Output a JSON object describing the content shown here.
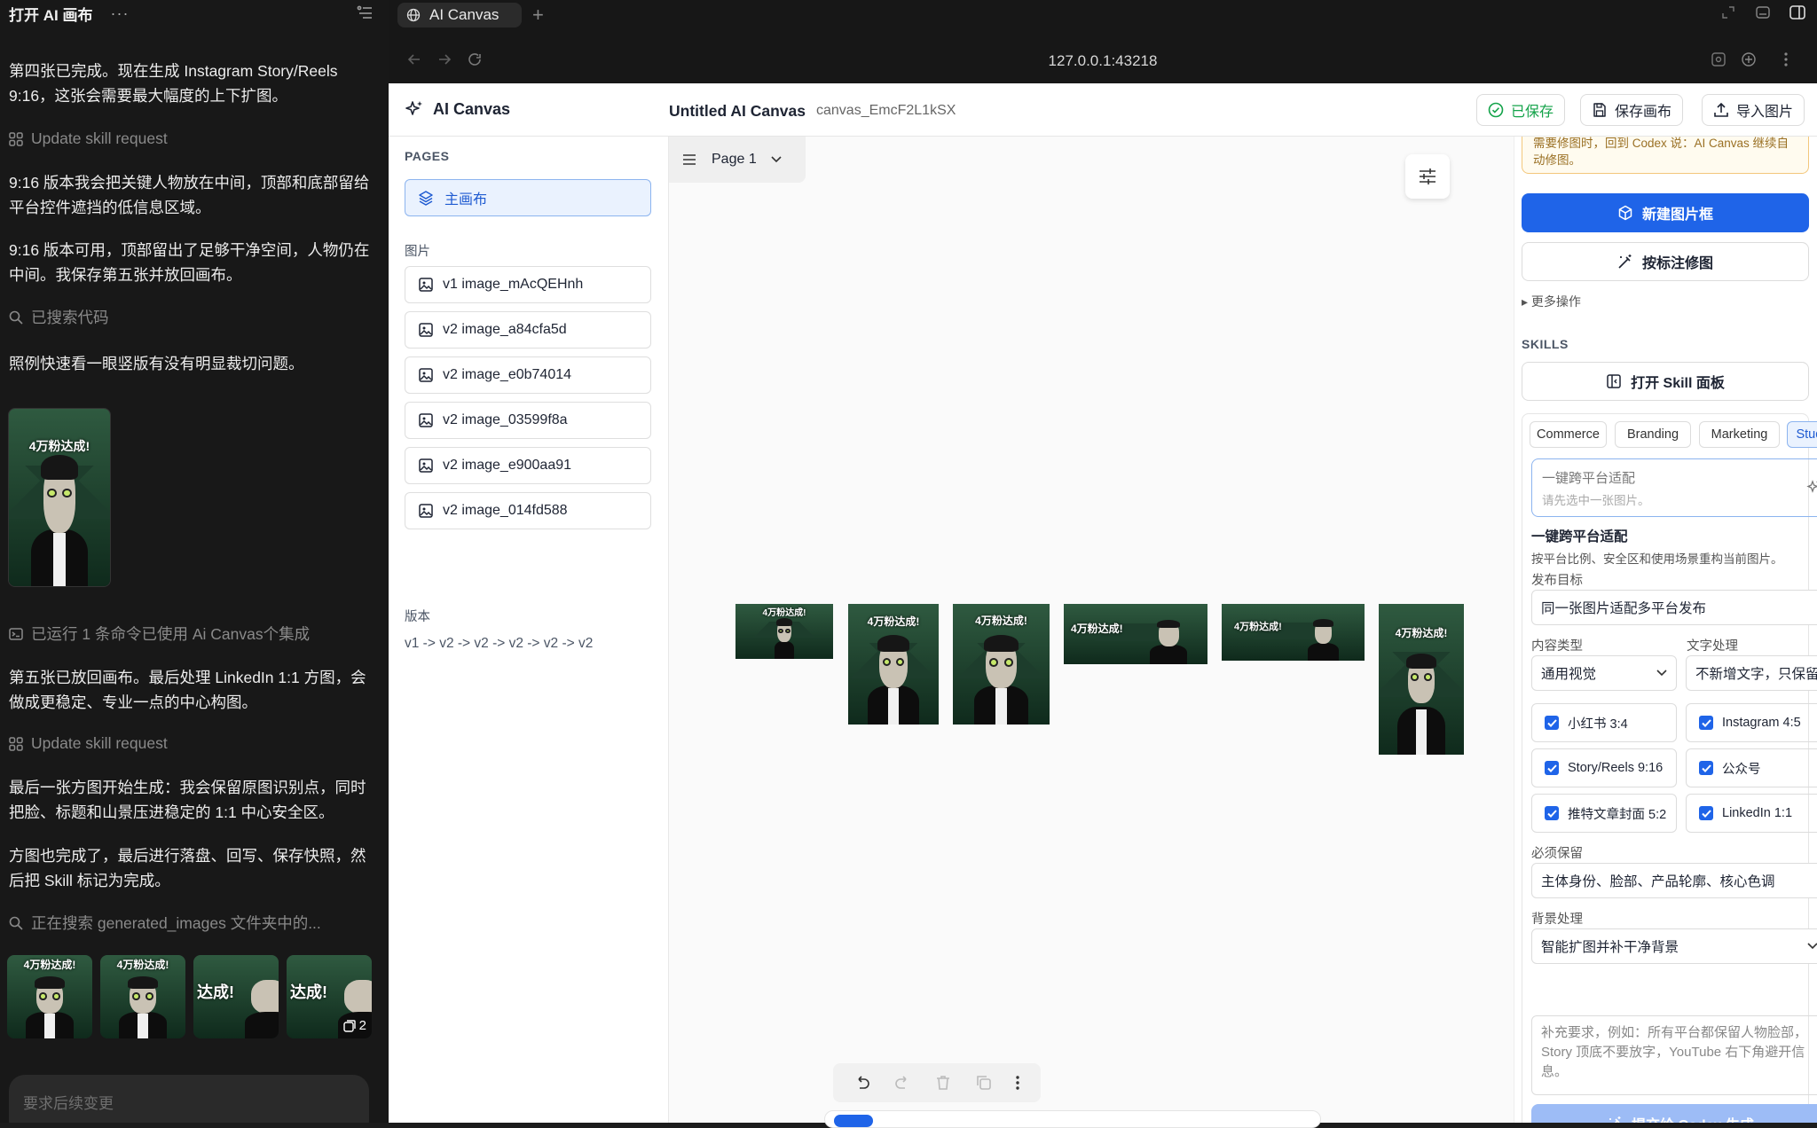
{
  "chat": {
    "title": "打开 AI 画布",
    "more": "···",
    "messages": [
      "第四张已完成。现在生成 Instagram Story/Reels 9:16，这张会需要最大幅度的上下扩图。",
      "9:16 版本我会把关键人物放在中间，顶部和底部留给平台控件遮挡的低信息区域。",
      "9:16 版本可用，顶部留出了足够干净空间，人物仍在中间。我保存第五张并放回画布。",
      "照例快速看一眼竖版有没有明显裁切问题。",
      "第五张已放回画布。最后处理 LinkedIn 1:1 方图，会做成更稳定、专业一点的中心构图。",
      "最后一张方图开始生成：我会保留原图识别点，同时把脸、标题和山景压进稳定的 1:1 中心安全区。",
      "方图也完成了，最后进行落盘、回写、保存快照，然后把 Skill 标记为完成。"
    ],
    "meta": {
      "update1": "Update skill request",
      "searched": "已搜索代码",
      "ran": "已运行 1 条命令已使用 Ai Canvas个集成",
      "update2": "Update skill request",
      "searching": "正在搜索 generated_images 文件夹中的..."
    },
    "thumb_caption": "4万粉达成!",
    "thumb_captions_row": [
      "4万粉达成!",
      "4万粉达成!",
      "达成!",
      "达成!"
    ],
    "thumb_count": "2",
    "input_placeholder": "要求后续变更"
  },
  "browser": {
    "tab_title": "AI Canvas",
    "url": "127.0.0.1:43218"
  },
  "app": {
    "name": "AI Canvas",
    "doc_title": "Untitled AI Canvas",
    "doc_id": "canvas_EmcF2L1kSX",
    "saved": "已保存",
    "save_canvas": "保存画布",
    "import_image": "导入图片"
  },
  "sidebar": {
    "pages_header": "PAGES",
    "main_page": "主画布",
    "images_header": "图片",
    "images": [
      "v1 image_mAcQEHnh",
      "v2 image_a84cfa5d",
      "v2 image_e0b74014",
      "v2 image_03599f8a",
      "v2 image_e900aa91",
      "v2 image_014fd588"
    ],
    "versions_header": "版本",
    "versions": "v1 -> v2 -> v2 -> v2 -> v2 -> v2"
  },
  "canvas": {
    "page_label": "Page 1",
    "image_caption": "4万粉达成!"
  },
  "panel": {
    "note": "需要修图时，回到 Codex 说：AI Canvas 继续自动修图。",
    "new_frame": "新建图片框",
    "annotate": "按标注修图",
    "more_actions": "▸ 更多操作",
    "skills_header": "SKILLS",
    "open_skill": "打开 Skill 面板",
    "skill_tabs": [
      "Commerce",
      "Branding",
      "Marketing",
      "Studio"
    ],
    "skill_search_title": "一键跨平台适配",
    "skill_search_sub": "请先选中一张图片。",
    "skill_title": "一键跨平台适配",
    "skill_desc": "按平台比例、安全区和使用场景重构当前图片。",
    "target_label": "发布目标",
    "target_value": "同一张图片适配多平台发布",
    "content_type_label": "内容类型",
    "content_type_value": "通用视觉",
    "text_label": "文字处理",
    "text_value": "不新增文字，只保留",
    "platforms": [
      "小红书 3:4",
      "Instagram 4:5",
      "Story/Reels 9:16",
      "公众号",
      "推特文章封面 5:2",
      "LinkedIn 1:1"
    ],
    "keep_label": "必须保留",
    "keep_value": "主体身份、脸部、产品轮廓、核心色调",
    "bg_label": "背景处理",
    "bg_value": "智能扩图并补干净背景",
    "extra_placeholder": "补充要求，例如：所有平台都保留人物脸部，Story 顶底不要放字，YouTube 右下角避开信息。",
    "submit": "提交给 Codex 生成"
  },
  "colors": {
    "accent": "#1f64e8",
    "saved_green": "#14a34a",
    "note_border": "#f3c77b"
  }
}
